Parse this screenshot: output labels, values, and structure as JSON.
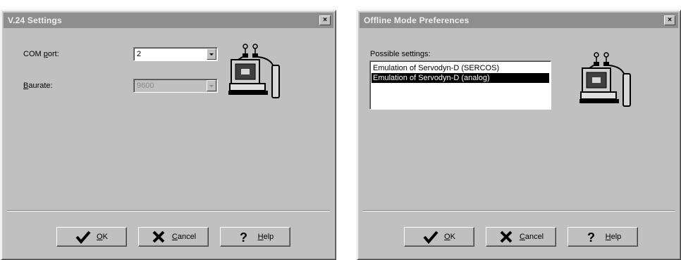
{
  "v24_dialog": {
    "title": "V.24 Settings",
    "close_label": "×",
    "com_port": {
      "label_prefix": "COM ",
      "label_accel": "p",
      "label_suffix": "ort:",
      "value": "2"
    },
    "baudrate": {
      "label_accel": "B",
      "label_suffix": "aurate:",
      "value": "9600",
      "disabled": true
    },
    "icon": "computer-with-cable-icon",
    "buttons": {
      "ok": {
        "accel": "O",
        "rest": "K",
        "icon": "checkmark-icon"
      },
      "cancel": {
        "accel": "C",
        "rest": "ancel",
        "icon": "x-mark-icon"
      },
      "help": {
        "accel": "H",
        "rest": "elp",
        "icon": "question-mark-icon"
      }
    }
  },
  "offline_dialog": {
    "title": "Offline Mode Preferences",
    "close_label": "×",
    "list_label": "Possible settings:",
    "list_items": [
      {
        "text": "Emulation of Servodyn-D (SERCOS)",
        "selected": false
      },
      {
        "text": "Emulation of Servodyn-D (analog)",
        "selected": true
      }
    ],
    "icon": "computer-with-cable-icon",
    "buttons": {
      "ok": {
        "accel": "O",
        "rest": "K",
        "icon": "checkmark-icon"
      },
      "cancel": {
        "accel": "C",
        "rest": "ancel",
        "icon": "x-mark-icon"
      },
      "help": {
        "accel": "H",
        "rest": "elp",
        "icon": "question-mark-icon"
      }
    }
  }
}
